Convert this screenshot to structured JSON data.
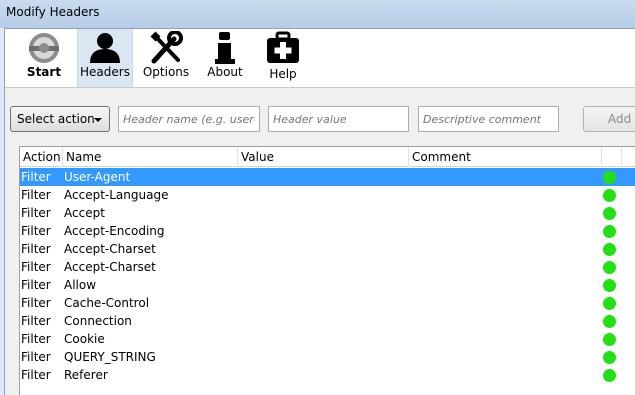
{
  "window": {
    "title": "Modify Headers"
  },
  "toolbar": {
    "items": [
      {
        "label": "Start",
        "icon": "start-icon"
      },
      {
        "label": "Headers",
        "icon": "user-icon"
      },
      {
        "label": "Options",
        "icon": "tools-icon"
      },
      {
        "label": "About",
        "icon": "info-icon"
      },
      {
        "label": "Help",
        "icon": "first-aid-icon"
      }
    ],
    "active": "Headers"
  },
  "form": {
    "action_select": "Select action",
    "header_name_placeholder": "Header name (e.g. user-a",
    "header_value_placeholder": "Header value",
    "comment_placeholder": "Descriptive comment",
    "add_label": "Add"
  },
  "table": {
    "columns": [
      "Action",
      "Name",
      "Value",
      "Comment"
    ],
    "rows": [
      {
        "action": "Filter",
        "name": "User-Agent",
        "value": "",
        "comment": "",
        "status": "enabled"
      },
      {
        "action": "Filter",
        "name": "Accept-Language",
        "value": "",
        "comment": "",
        "status": "enabled"
      },
      {
        "action": "Filter",
        "name": "Accept",
        "value": "",
        "comment": "",
        "status": "enabled"
      },
      {
        "action": "Filter",
        "name": "Accept-Encoding",
        "value": "",
        "comment": "",
        "status": "enabled"
      },
      {
        "action": "Filter",
        "name": "Accept-Charset",
        "value": "",
        "comment": "",
        "status": "enabled"
      },
      {
        "action": "Filter",
        "name": "Accept-Charset",
        "value": "",
        "comment": "",
        "status": "enabled"
      },
      {
        "action": "Filter",
        "name": "Allow",
        "value": "",
        "comment": "",
        "status": "enabled"
      },
      {
        "action": "Filter",
        "name": "Cache-Control",
        "value": "",
        "comment": "",
        "status": "enabled"
      },
      {
        "action": "Filter",
        "name": "Connection",
        "value": "",
        "comment": "",
        "status": "enabled"
      },
      {
        "action": "Filter",
        "name": "Cookie",
        "value": "",
        "comment": "",
        "status": "enabled"
      },
      {
        "action": "Filter",
        "name": "QUERY_STRING",
        "value": "",
        "comment": "",
        "status": "enabled"
      },
      {
        "action": "Filter",
        "name": "Referer",
        "value": "",
        "comment": "",
        "status": "enabled"
      }
    ],
    "selected_row": 0
  },
  "colors": {
    "selection": "#3399ff",
    "status_enabled": "#22e011",
    "active_tab": "#dbe6f3"
  }
}
